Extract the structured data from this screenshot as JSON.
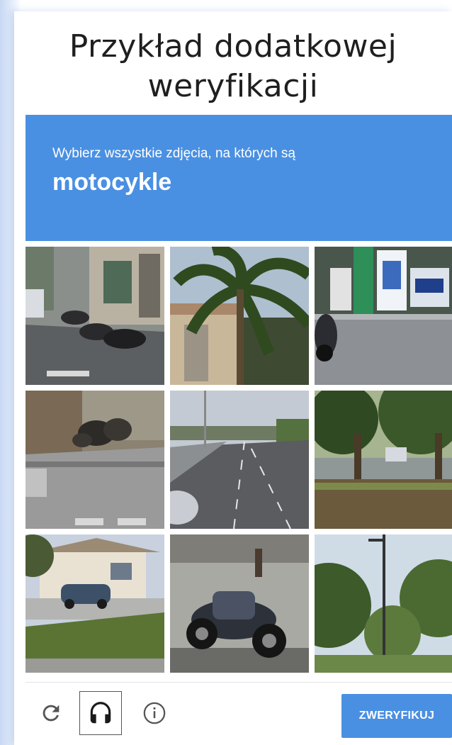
{
  "header": {
    "title_line1": "Przykład dodatkowej",
    "title_line2": "weryfikacji"
  },
  "challenge": {
    "instruction": "Wybierz wszystkie zdjęcia, na których są",
    "target": "motocykle",
    "accent_color": "#4a90e2"
  },
  "tiles": [
    {
      "subject": "street-with-parked-motorcycles"
    },
    {
      "subject": "palm-tree"
    },
    {
      "subject": "shop-front-with-scooter"
    },
    {
      "subject": "street-corner-with-motorcycles"
    },
    {
      "subject": "highway"
    },
    {
      "subject": "park-trees-with-car"
    },
    {
      "subject": "house-with-car"
    },
    {
      "subject": "parked-motorcycle"
    },
    {
      "subject": "trees-and-lamp-post"
    }
  ],
  "footer": {
    "reload_icon": "reload-icon",
    "audio_icon": "headphones-icon",
    "info_icon": "info-icon",
    "verify_label": "ZWERYFIKUJ"
  }
}
